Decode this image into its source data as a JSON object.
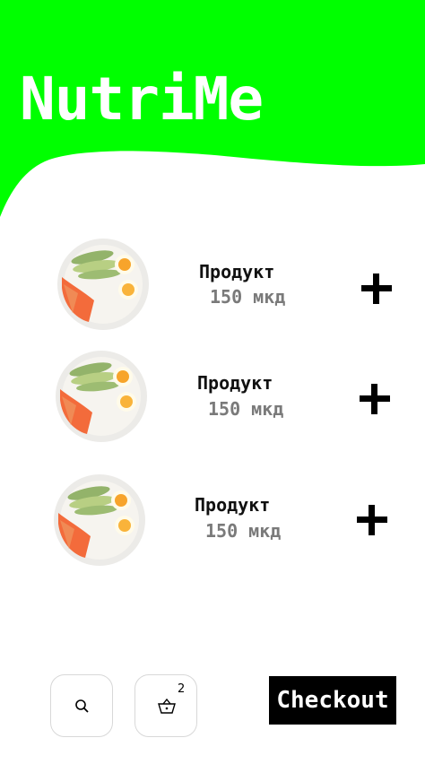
{
  "app": {
    "title": "NutriMe"
  },
  "colors": {
    "header_green": "#00ff00",
    "price_gray": "#7a7a7a"
  },
  "products": [
    {
      "name": "Продукт",
      "price": "150 мкд"
    },
    {
      "name": "Продукт",
      "price": "150 мкд"
    },
    {
      "name": "Продукт",
      "price": "150 мкд"
    }
  ],
  "footer": {
    "search_icon": "magnifier-icon",
    "cart_icon": "basket-icon",
    "cart_count": "2",
    "checkout_label": "Checkout"
  }
}
